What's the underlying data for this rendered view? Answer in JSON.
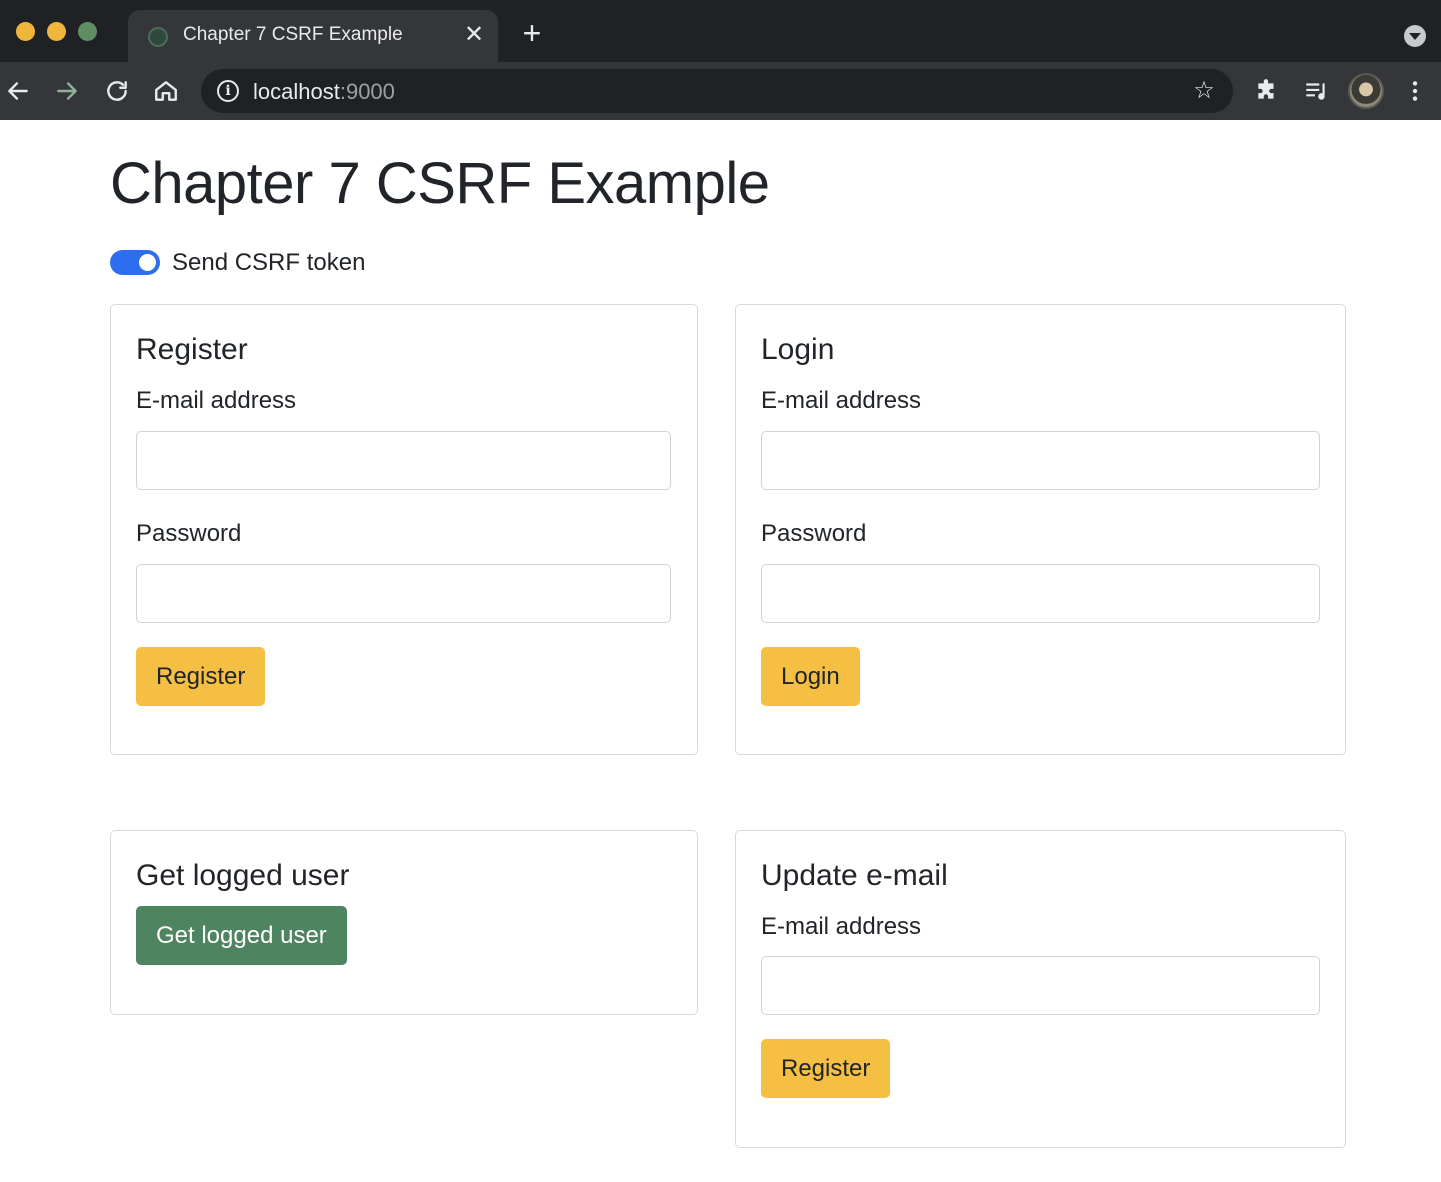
{
  "browser": {
    "tab_title": "Chapter 7 CSRF Example",
    "tab_close": "✕",
    "new_tab": "+",
    "url_host": "localhost",
    "url_port": ":9000"
  },
  "page": {
    "title": "Chapter 7 CSRF Example",
    "csrf_toggle": {
      "label": "Send CSRF token",
      "checked": true
    }
  },
  "register": {
    "title": "Register",
    "email_label": "E-mail address",
    "password_label": "Password",
    "button": "Register"
  },
  "login": {
    "title": "Login",
    "email_label": "E-mail address",
    "password_label": "Password",
    "button": "Login"
  },
  "logged_user": {
    "title": "Get logged user",
    "button": "Get logged user"
  },
  "update_email": {
    "title": "Update e-mail",
    "email_label": "E-mail address",
    "button": "Register"
  },
  "colors": {
    "primary": "#2d6ef0",
    "warning": "#f4bf42",
    "success": "#4e8460"
  }
}
